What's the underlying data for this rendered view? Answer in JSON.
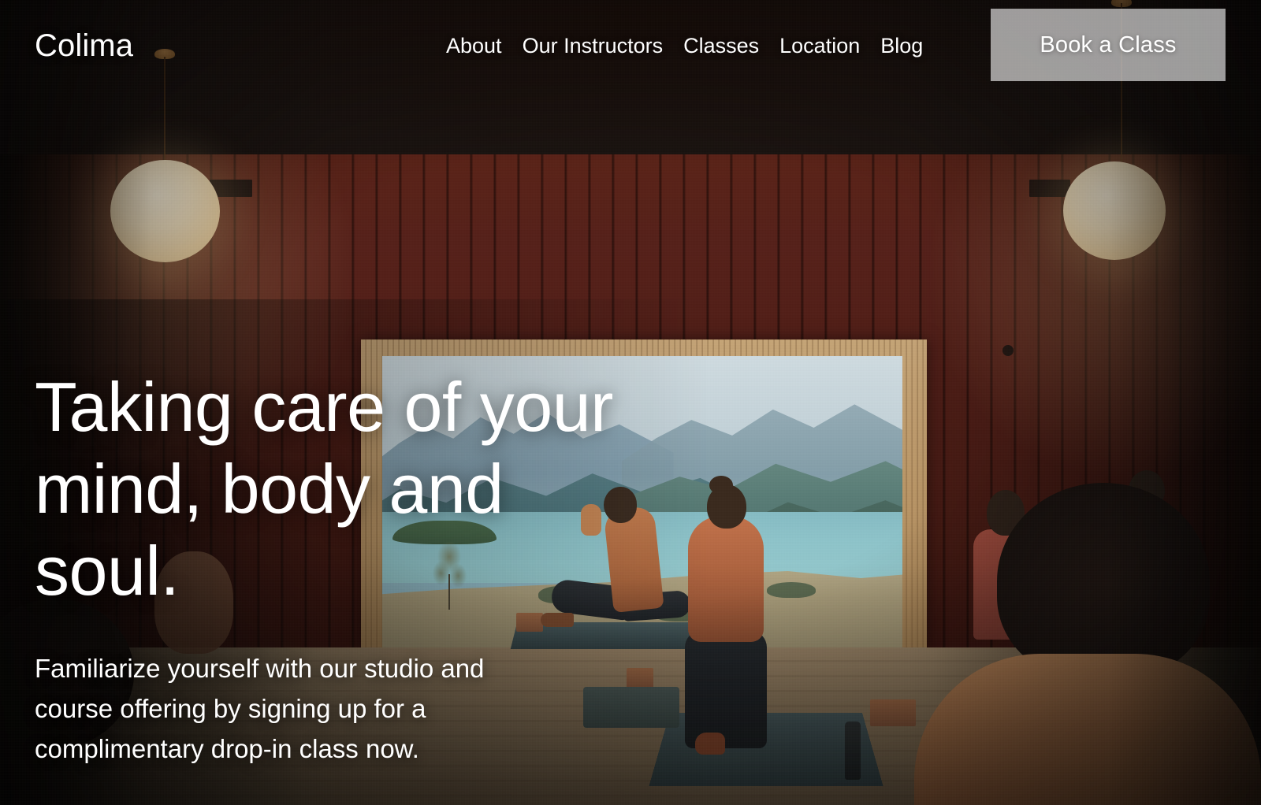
{
  "site": {
    "brand": "Colima"
  },
  "nav": {
    "items": [
      {
        "label": "About"
      },
      {
        "label": "Our Instructors"
      },
      {
        "label": "Classes"
      },
      {
        "label": "Location"
      },
      {
        "label": "Blog"
      }
    ],
    "cta": {
      "label": "Book a Class"
    }
  },
  "hero": {
    "headline_line1": "Taking care of your",
    "headline_line2": "mind, body and",
    "headline_line3": "soul.",
    "subcopy_line1": "Familiarize yourself with our studio and",
    "subcopy_line2": "course offering by signing up for a",
    "subcopy_line3": "complimentary drop-in class now."
  },
  "colors": {
    "text_on_image": "#ffffff",
    "cta_background": "#a9a9a7",
    "ceiling_warm": "#c08030",
    "wall_red_brown": "#4d1d16",
    "lake_teal": "#8ec4ca",
    "floor_wood": "#8e7a5e",
    "lamp_glow": "#f7e6c4"
  },
  "scene": {
    "description": "Yoga studio interior, timber ceiling and red-brown board wall, two globe pendant lamps, wide opening to a lake and mountain view, practitioners on mats"
  }
}
